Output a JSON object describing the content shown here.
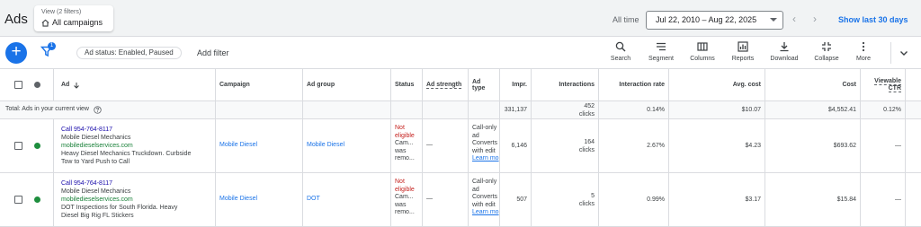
{
  "header": {
    "app_title": "Ads",
    "view_sub": "View (2 filters)",
    "view_main": "All campaigns",
    "all_time": "All time",
    "date_range": "Jul 22, 2010 – Aug 22, 2025",
    "show_last": "Show last 30 days"
  },
  "toolbar": {
    "filter_count": "1",
    "chip": "Ad status: Enabled, Paused",
    "add_filter": "Add filter",
    "tools": {
      "search": "Search",
      "segment": "Segment",
      "columns": "Columns",
      "reports": "Reports",
      "download": "Download",
      "collapse": "Collapse",
      "more": "More"
    }
  },
  "table": {
    "headers": {
      "ad": "Ad",
      "campaign": "Campaign",
      "ad_group": "Ad group",
      "status": "Status",
      "ad_strength": "Ad strength",
      "ad_type_1": "Ad",
      "ad_type_2": "type",
      "impr": "Impr.",
      "interactions": "Interactions",
      "interaction_rate": "Interaction rate",
      "avg_cost": "Avg. cost",
      "cost": "Cost",
      "viewable_1": "Viewable",
      "viewable_2": "CTR"
    },
    "total": {
      "label": "Total: Ads in your current view",
      "impr": "331,137",
      "interactions_1": "452",
      "interactions_2": "clicks",
      "interaction_rate": "0.14%",
      "avg_cost": "$10.07",
      "cost": "$4,552.41",
      "viewable_ctr": "0.12%"
    },
    "rows": [
      {
        "call": "Call 954-764-8117",
        "business": "Mobile Diesel Mechanics",
        "url": "mobiledieselservices.com",
        "desc_1": "Heavy Diesel Mechanics Truckdown. Curbside",
        "desc_2": "Tow to Yard Push to Call",
        "campaign": "Mobile Diesel",
        "ad_group": "Mobile Diesel",
        "status_1": "Not",
        "status_2": "eligible",
        "status_3": "Cam...",
        "status_4": "was",
        "status_5": "remo...",
        "ad_strength": "—",
        "type_1": "Call-only",
        "type_2": "ad",
        "type_3": "Converts",
        "type_4": "with edit",
        "type_5": "Learn mo",
        "impr": "6,146",
        "interactions_1": "164",
        "interactions_2": "clicks",
        "interaction_rate": "2.67%",
        "avg_cost": "$4.23",
        "cost": "$693.62",
        "viewable_ctr": "—"
      },
      {
        "call": "Call 954-764-8117",
        "business": "Mobile Diesel Mechanics",
        "url": "mobiledieselservices.com",
        "desc_1": "DOT Inspections for South Florida. Heavy",
        "desc_2": "Diesel Big Rig FL Stickers",
        "campaign": "Mobile Diesel",
        "ad_group": "DOT",
        "status_1": "Not",
        "status_2": "eligible",
        "status_3": "Cam...",
        "status_4": "was",
        "status_5": "remo...",
        "ad_strength": "—",
        "type_1": "Call-only",
        "type_2": "ad",
        "type_3": "Converts",
        "type_4": "with edit",
        "type_5": "Learn mo",
        "impr": "507",
        "interactions_1": "5",
        "interactions_2": "clicks",
        "interaction_rate": "0.99%",
        "avg_cost": "$3.17",
        "cost": "$15.84",
        "viewable_ctr": "—"
      }
    ]
  },
  "colors": {
    "accent": "#1a73e8",
    "status_red": "#c5221f",
    "enabled_green": "#1e8e3e",
    "url_green": "#188038"
  },
  "icons": [
    "home-icon",
    "plus-icon",
    "filter-icon",
    "search-icon",
    "segment-icon",
    "columns-icon",
    "reports-icon",
    "download-icon",
    "collapse-icon",
    "more-icon",
    "chevron-down-icon",
    "chevron-left-icon",
    "chevron-right-icon",
    "help-icon",
    "sort-arrow-icon"
  ]
}
